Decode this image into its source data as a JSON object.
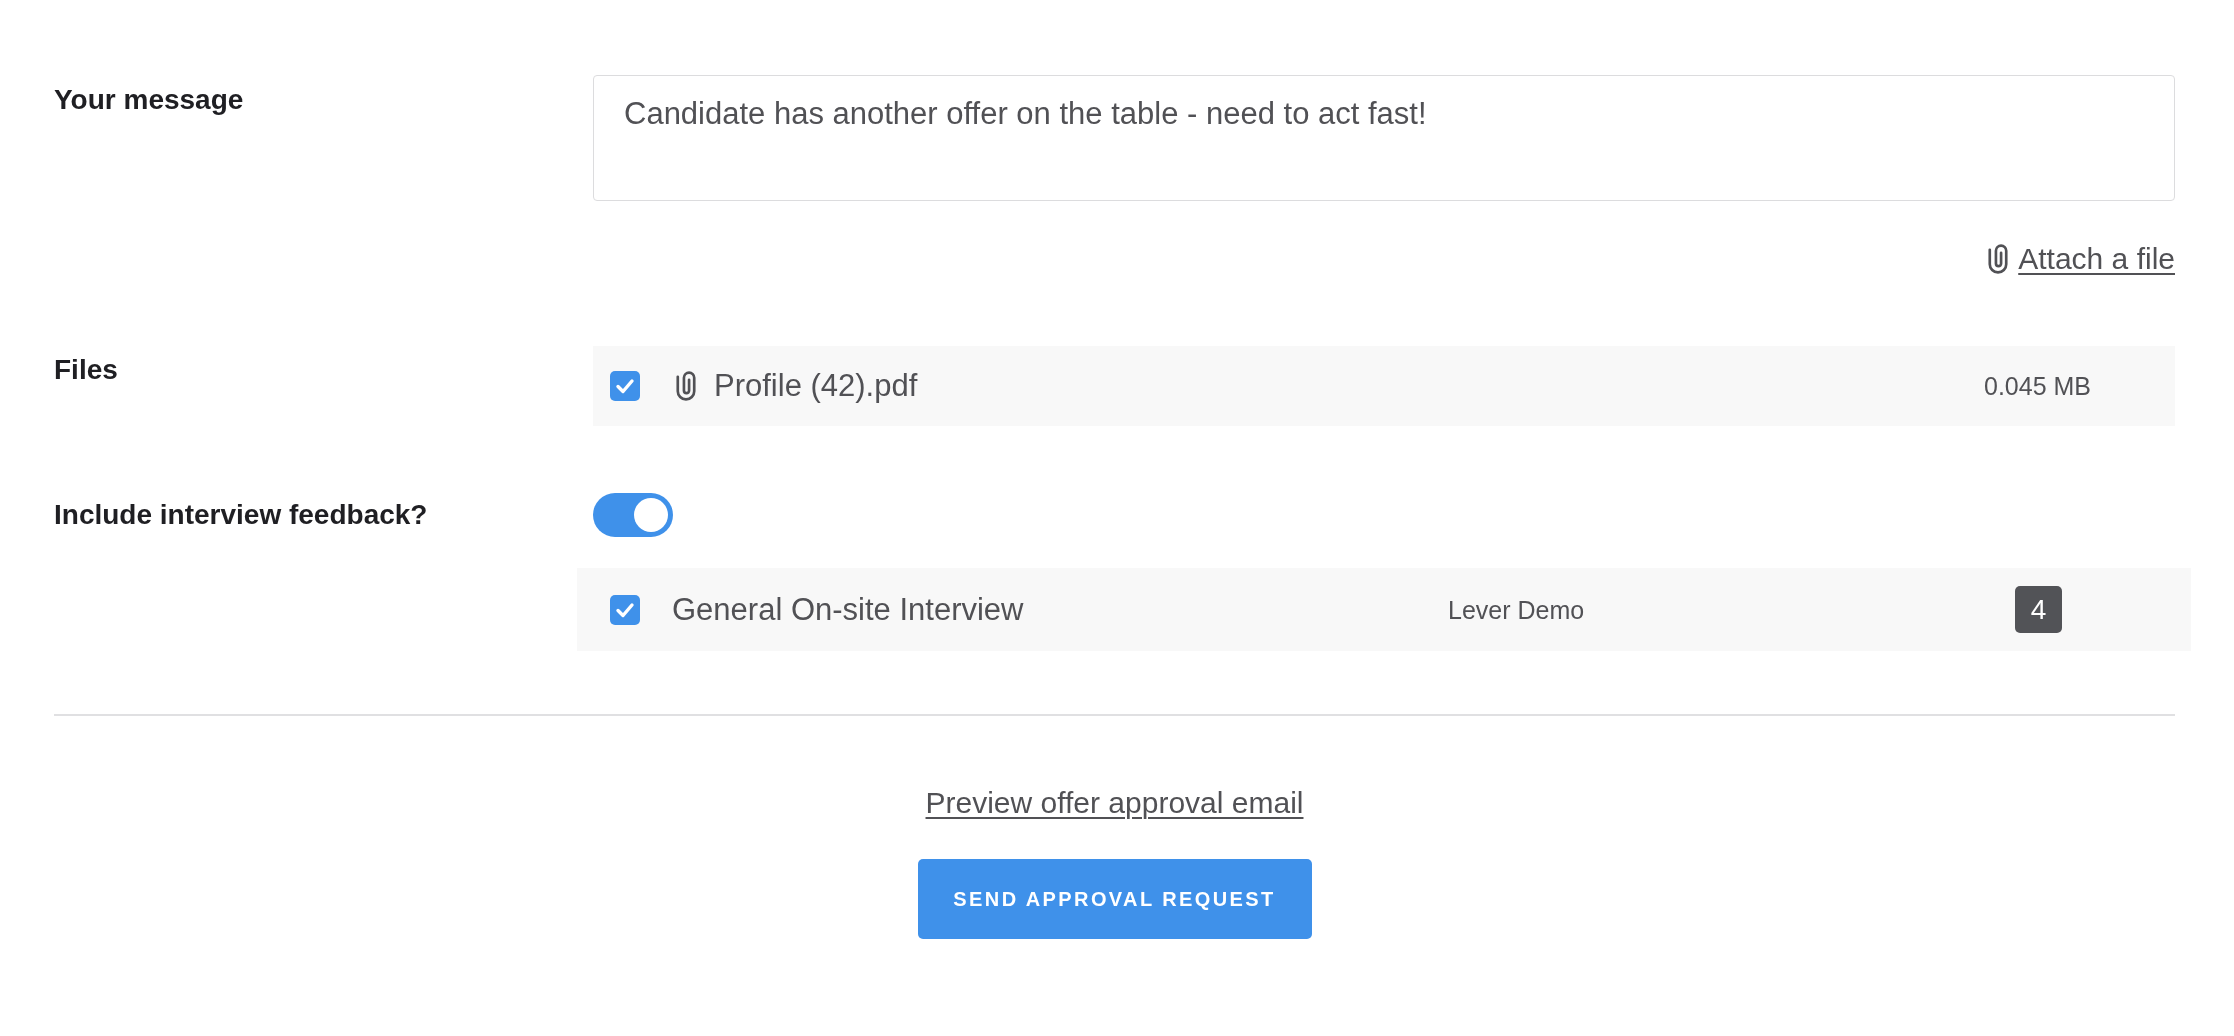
{
  "message": {
    "label": "Your message",
    "value": "Candidate has another offer on the table - need to act fast!",
    "attach_link": "Attach a file"
  },
  "files": {
    "label": "Files",
    "items": [
      {
        "name": "Profile (42).pdf",
        "size": "0.045 MB",
        "checked": true
      }
    ]
  },
  "interview_feedback": {
    "label": "Include interview feedback?",
    "on": true,
    "items": [
      {
        "title": "General On-site Interview",
        "column_2": "Lever Demo",
        "badge": "4",
        "checked": true
      }
    ]
  },
  "preview_link": "Preview offer approval email",
  "submit_button": "SEND APPROVAL REQUEST"
}
